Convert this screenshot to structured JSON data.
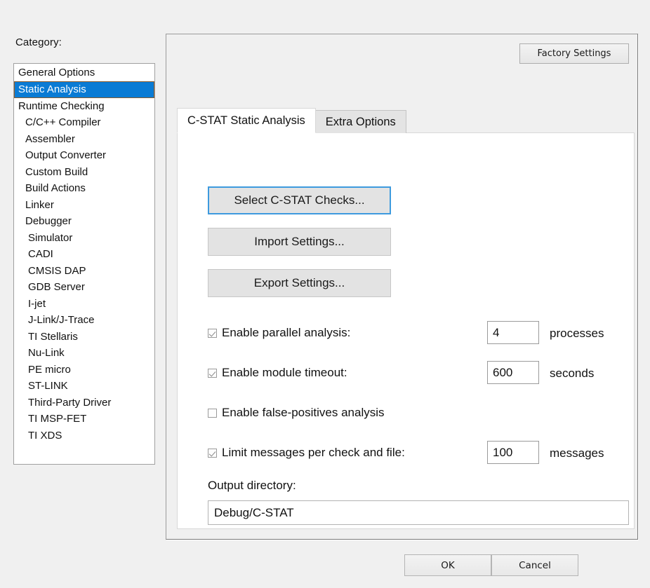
{
  "sidebar": {
    "label": "Category:",
    "items": [
      {
        "label": "General Options",
        "indent": 0,
        "selected": false
      },
      {
        "label": "Static Analysis",
        "indent": 0,
        "selected": true
      },
      {
        "label": "Runtime Checking",
        "indent": 0,
        "selected": false
      },
      {
        "label": "C/C++ Compiler",
        "indent": 1,
        "selected": false
      },
      {
        "label": "Assembler",
        "indent": 1,
        "selected": false
      },
      {
        "label": "Output Converter",
        "indent": 1,
        "selected": false
      },
      {
        "label": "Custom Build",
        "indent": 1,
        "selected": false
      },
      {
        "label": "Build Actions",
        "indent": 1,
        "selected": false
      },
      {
        "label": "Linker",
        "indent": 1,
        "selected": false
      },
      {
        "label": "Debugger",
        "indent": 1,
        "selected": false
      },
      {
        "label": "Simulator",
        "indent": 2,
        "selected": false
      },
      {
        "label": "CADI",
        "indent": 2,
        "selected": false
      },
      {
        "label": "CMSIS DAP",
        "indent": 2,
        "selected": false
      },
      {
        "label": "GDB Server",
        "indent": 2,
        "selected": false
      },
      {
        "label": "I-jet",
        "indent": 2,
        "selected": false
      },
      {
        "label": "J-Link/J-Trace",
        "indent": 2,
        "selected": false
      },
      {
        "label": "TI Stellaris",
        "indent": 2,
        "selected": false
      },
      {
        "label": "Nu-Link",
        "indent": 2,
        "selected": false
      },
      {
        "label": "PE micro",
        "indent": 2,
        "selected": false
      },
      {
        "label": "ST-LINK",
        "indent": 2,
        "selected": false
      },
      {
        "label": "Third-Party Driver",
        "indent": 2,
        "selected": false
      },
      {
        "label": "TI MSP-FET",
        "indent": 2,
        "selected": false
      },
      {
        "label": "TI XDS",
        "indent": 2,
        "selected": false
      }
    ]
  },
  "panel": {
    "factory_settings_label": "Factory Settings",
    "tabs": [
      {
        "label": "C-STAT Static Analysis",
        "active": true
      },
      {
        "label": "Extra Options",
        "active": false
      }
    ],
    "buttons": [
      {
        "label": "Select C-STAT Checks...",
        "focused": true
      },
      {
        "label": "Import Settings...",
        "focused": false
      },
      {
        "label": "Export Settings...",
        "focused": false
      }
    ],
    "options": [
      {
        "label": "Enable parallel analysis:",
        "checked": true,
        "value": "4",
        "unit": "processes"
      },
      {
        "label": "Enable module timeout:",
        "checked": true,
        "value": "600",
        "unit": "seconds"
      },
      {
        "label": "Enable false-positives analysis",
        "checked": false,
        "value": null,
        "unit": null
      },
      {
        "label": "Limit messages per check and file:",
        "checked": true,
        "value": "100",
        "unit": "messages"
      }
    ],
    "output_directory": {
      "label": "Output directory:",
      "value": "Debug/C-STAT"
    }
  },
  "footer": {
    "ok_label": "OK",
    "cancel_label": "Cancel"
  },
  "colors": {
    "selection_blue": "#0a7bd4",
    "selection_border": "#8a5a2b",
    "focus_blue": "#3d9ade",
    "window_bg": "#f0f0f0",
    "field_bg": "#ffffff"
  }
}
